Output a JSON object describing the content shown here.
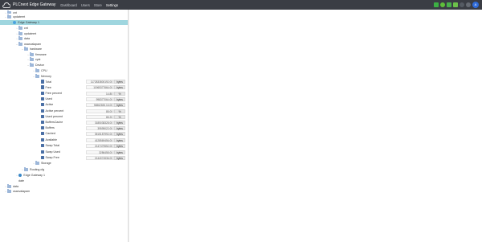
{
  "header": {
    "brand": "PLCnext Edge Gateway",
    "nav": [
      {
        "label": "Dashboard",
        "active": false
      },
      {
        "label": "Users",
        "active": false
      },
      {
        "label": "Store",
        "active": false
      },
      {
        "label": "Settings",
        "active": true
      }
    ],
    "icons": [
      "green-status-icon",
      "green-status-icon",
      "green-status-icon",
      "green-status-icon",
      "github-icon",
      "help-icon"
    ],
    "avatar": "A"
  },
  "tree": {
    "items": [
      {
        "label": "cnt",
        "icon": "folder",
        "toggle": "›"
      },
      {
        "label": "updateert",
        "icon": "folder",
        "toggle": "⌄"
      },
      {
        "label": "Edge Gateway 1",
        "icon": "gateway",
        "toggle": "⌄",
        "selected": true
      },
      {
        "label": "cnt",
        "icon": "folder",
        "toggle": "›"
      },
      {
        "label": "updateert",
        "icon": "folder",
        "toggle": "›"
      },
      {
        "label": "data",
        "icon": "folder",
        "toggle": "›"
      },
      {
        "label": "osaxvalapam",
        "icon": "folder",
        "toggle": "⌄"
      },
      {
        "label": "hardware",
        "icon": "folder",
        "toggle": "⌄"
      },
      {
        "label": "firmware",
        "icon": "folder",
        "toggle": "›"
      },
      {
        "label": "cyst",
        "icon": "folder",
        "toggle": "›"
      },
      {
        "label": "Device",
        "icon": "folder",
        "toggle": "⌄"
      },
      {
        "label": "CPU",
        "icon": "folder",
        "toggle": "›"
      },
      {
        "label": "Memory",
        "icon": "folder",
        "toggle": "⌄"
      },
      {
        "label": "Total",
        "icon": "data",
        "value": "1172833800192.00",
        "unit": "bytes"
      },
      {
        "label": "Free",
        "icon": "data",
        "value": "11965377664.00",
        "unit": "bytes"
      },
      {
        "label": "Free percent",
        "icon": "data",
        "value": "14.80",
        "unit": "%"
      },
      {
        "label": "Used",
        "icon": "data",
        "value": "998377064.00",
        "unit": "bytes"
      },
      {
        "label": "Active",
        "icon": "data",
        "value": "56562830.16.00",
        "unit": "bytes"
      },
      {
        "label": "Active percent",
        "icon": "data",
        "value": "85.00",
        "unit": "%"
      },
      {
        "label": "Used percent",
        "icon": "data",
        "value": "85.20",
        "unit": "%"
      },
      {
        "label": "BuffersCache",
        "icon": "data",
        "value": "3185038328.00",
        "unit": "bytes"
      },
      {
        "label": "Buffers",
        "icon": "data",
        "value": "39595022.00",
        "unit": "bytes"
      },
      {
        "label": "Cached",
        "icon": "data",
        "value": "3515187992.00",
        "unit": "bytes"
      },
      {
        "label": "Available",
        "icon": "data",
        "value": "4128569456.00",
        "unit": "bytes"
      },
      {
        "label": "Swap Total",
        "icon": "data",
        "value": "2147479552.00",
        "unit": "bytes"
      },
      {
        "label": "Swap Used",
        "icon": "data",
        "value": "3286458.00",
        "unit": "bytes"
      },
      {
        "label": "Swap Free",
        "icon": "data",
        "value": "2144074536.00",
        "unit": "bytes"
      },
      {
        "label": "Storage",
        "icon": "folder",
        "toggle": "›"
      },
      {
        "label": "Routing.cfg",
        "icon": "folder",
        "toggle": "›"
      },
      {
        "label": "Edge Gateway 1",
        "icon": "gateway2",
        "toggle": "›"
      },
      {
        "label": "date",
        "icon": "none"
      },
      {
        "label": "data",
        "icon": "folder",
        "toggle": "›"
      },
      {
        "label": "osaxvalapam",
        "icon": "folder",
        "toggle": "›"
      }
    ]
  },
  "colors": {
    "topbar": "#3a3d44",
    "selected_row": "#9fd6df",
    "folder": "#9db7d9",
    "data_icon": "#4a6fa5",
    "status_green": "#3cb043",
    "avatar": "#2f6bd8"
  }
}
